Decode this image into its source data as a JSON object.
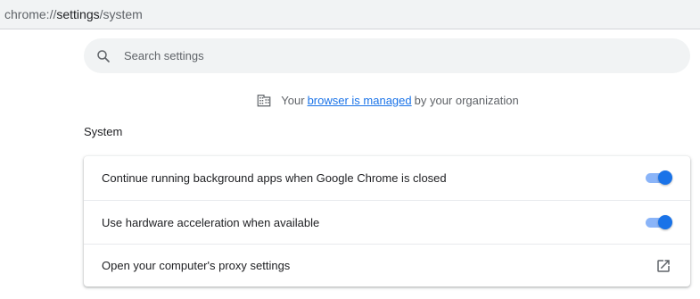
{
  "address_bar": {
    "scheme": "chrome://",
    "host": "settings",
    "path": "/system"
  },
  "search": {
    "placeholder": "Search settings",
    "icon": "search-icon"
  },
  "managed_notice": {
    "icon": "building-icon",
    "prefix": "Your",
    "link_text": "browser is managed",
    "suffix": "by your organization"
  },
  "section": {
    "title": "System",
    "rows": [
      {
        "label": "Continue running background apps when Google Chrome is closed",
        "control": "toggle",
        "on": true
      },
      {
        "label": "Use hardware acceleration when available",
        "control": "toggle",
        "on": true
      },
      {
        "label": "Open your computer's proxy settings",
        "control": "external-link",
        "icon": "open-in-new-icon"
      }
    ]
  },
  "colors": {
    "accent": "#1a73e8",
    "toggle_track": "#8ab4f8",
    "search_bg": "#f1f3f4",
    "secondary_text": "#5f6368"
  }
}
